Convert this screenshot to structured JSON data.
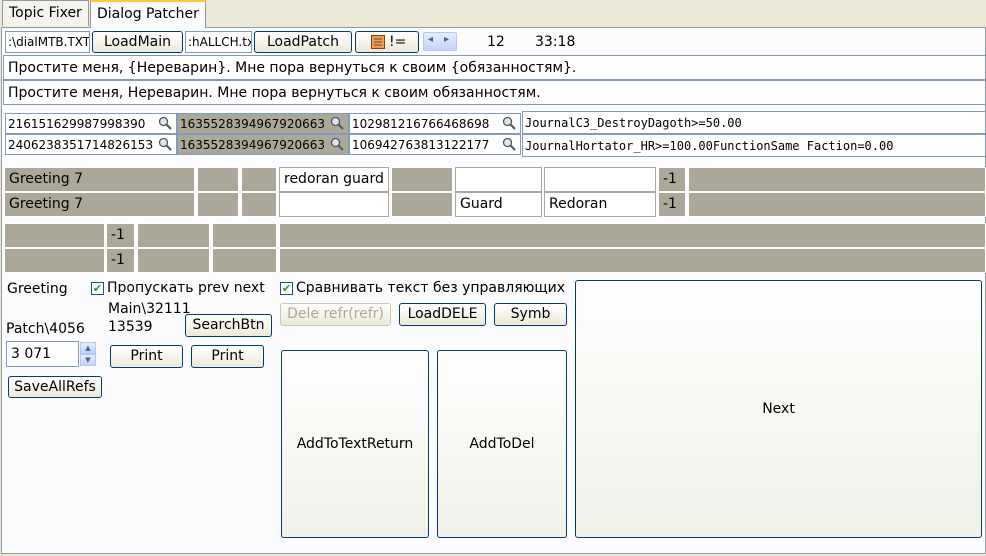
{
  "tabs": [
    {
      "label": "Topic Fixer"
    },
    {
      "label": "Dialog Patcher"
    }
  ],
  "row1": {
    "main_file": ":\\dialMTB.TXT",
    "load_main": "LoadMain",
    "patch_file": ":hALLCH.txt",
    "load_patch": "LoadPatch",
    "neq_label": "!=",
    "count": "12",
    "time": "33:18"
  },
  "text_line_1": "Простите меня, {Нереварин}. Мне пора вернуться к своим {обязанностям}.",
  "text_line_2": "Простите меня, Нереварин. Мне пора вернуться к своим обязанностям.",
  "ids": {
    "a1": "216151629987998390",
    "a2": "240623835171482615З",
    "b1": "1635528394967920663",
    "b2": "1635528394967920663",
    "c1": "102981216766468698",
    "c2": "106942763813122177"
  },
  "conditions": {
    "line1": "JournalC3_DestroyDagoth>=50.00",
    "line2": "JournalHortator_HR>=100.00FunctionSame Faction=0.00"
  },
  "grid": {
    "r1_name": "Greeting 7",
    "r2_name": "Greeting 7",
    "r1_text": "redoran guard fe",
    "r2_class": "Guard",
    "r2_faction": "Redoran",
    "r1_num": "-1",
    "r2_num": "-1",
    "r3_num": "-1",
    "r4_num": "-1"
  },
  "controls": {
    "greeting_label": "Greeting",
    "skip_prev_next": "Пропускать prev next",
    "compare_text": "Сравнивать текст без управляющих",
    "main_ref": "Main\\32111",
    "main_ref2": "13539",
    "patch_ref": "Patch\\4056",
    "search_btn": "SearchBtn",
    "dele_refr": "Dele refr(refr)",
    "load_dele": "LoadDELE",
    "symb": "Symb",
    "spin_value": "3 071",
    "print1": "Print",
    "print2": "Print",
    "save_all_refs": "SaveAllRefs",
    "add_to_text_return": "AddToTextReturn",
    "add_to_del": "AddToDel",
    "next": "Next"
  }
}
